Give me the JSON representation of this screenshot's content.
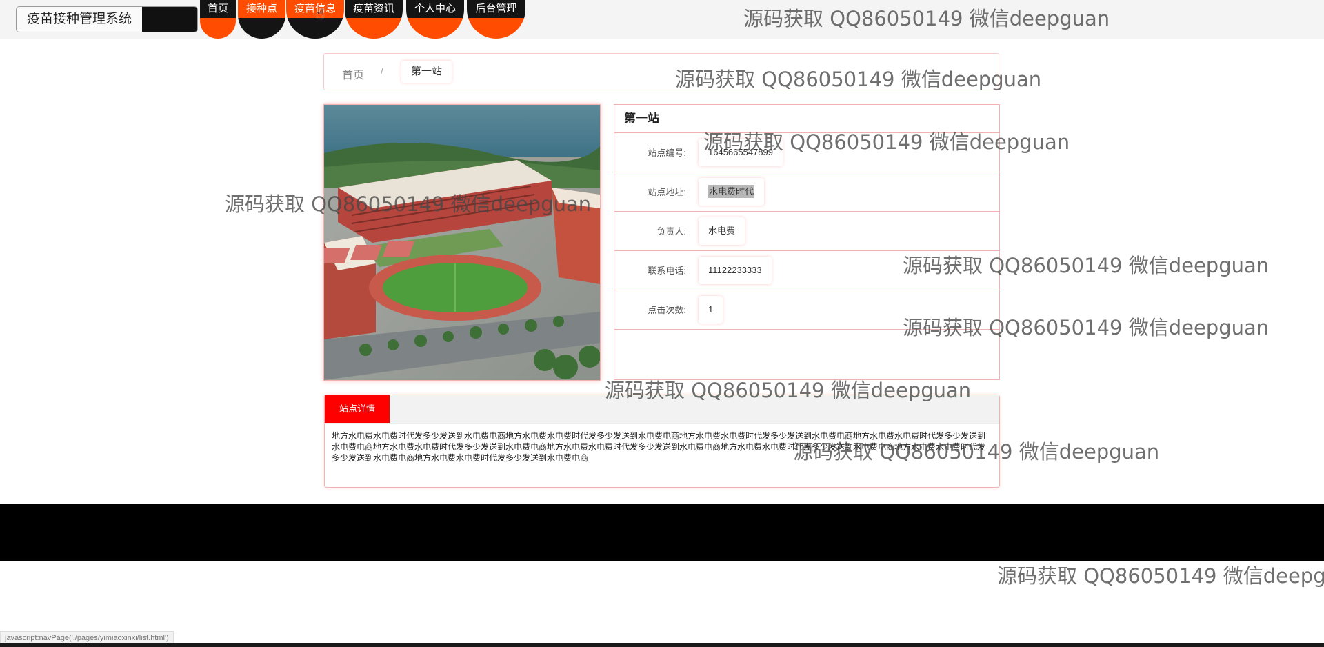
{
  "header": {
    "site_title": "疫苗接种管理系统",
    "nav": [
      {
        "label": "首页"
      },
      {
        "label": "接种点"
      },
      {
        "label": "疫苗信息"
      },
      {
        "label": "疫苗资讯"
      },
      {
        "label": "个人中心"
      },
      {
        "label": "后台管理"
      }
    ]
  },
  "breadcrumb": {
    "home": "首页",
    "separator": "/",
    "current": "第一站"
  },
  "station": {
    "title": "第一站",
    "fields": [
      {
        "label": "站点编号:",
        "value": "1645665547899"
      },
      {
        "label": "站点地址:",
        "value": "水电费时代"
      },
      {
        "label": "负责人:",
        "value": "水电费"
      },
      {
        "label": "联系电话:",
        "value": "11122233333"
      },
      {
        "label": "点击次数:",
        "value": "1"
      }
    ]
  },
  "details": {
    "tab_label": "站点详情",
    "text": "地方水电费水电费时代发多少发送到水电费电商地方水电费水电费时代发多少发送到水电费电商地方水电费水电费时代发多少发送到水电费电商地方水电费水电费时代发多少发送到水电费电商地方水电费水电费时代发多少发送到水电费电商地方水电费水电费时代发多少发送到水电费电商地方水电费水电费时代发多少发送到水电费电商地方水电费水电费时代发多少发送到水电费电商地方水电费水电费时代发多少发送到水电费电商"
  },
  "status_bar": {
    "url": "javascript:navPage('./pages/yimiaoxinxi/list.html')"
  },
  "watermark": {
    "text": "源码获取 QQ86050149 微信deepguan",
    "text_cut": "源码获取 QQ86050149 微信deepg"
  },
  "colors": {
    "accent_orange": "#ff4c00",
    "nav_black": "#141414",
    "tab_red": "#ff0000",
    "border_pink": "#f3b2b2"
  }
}
